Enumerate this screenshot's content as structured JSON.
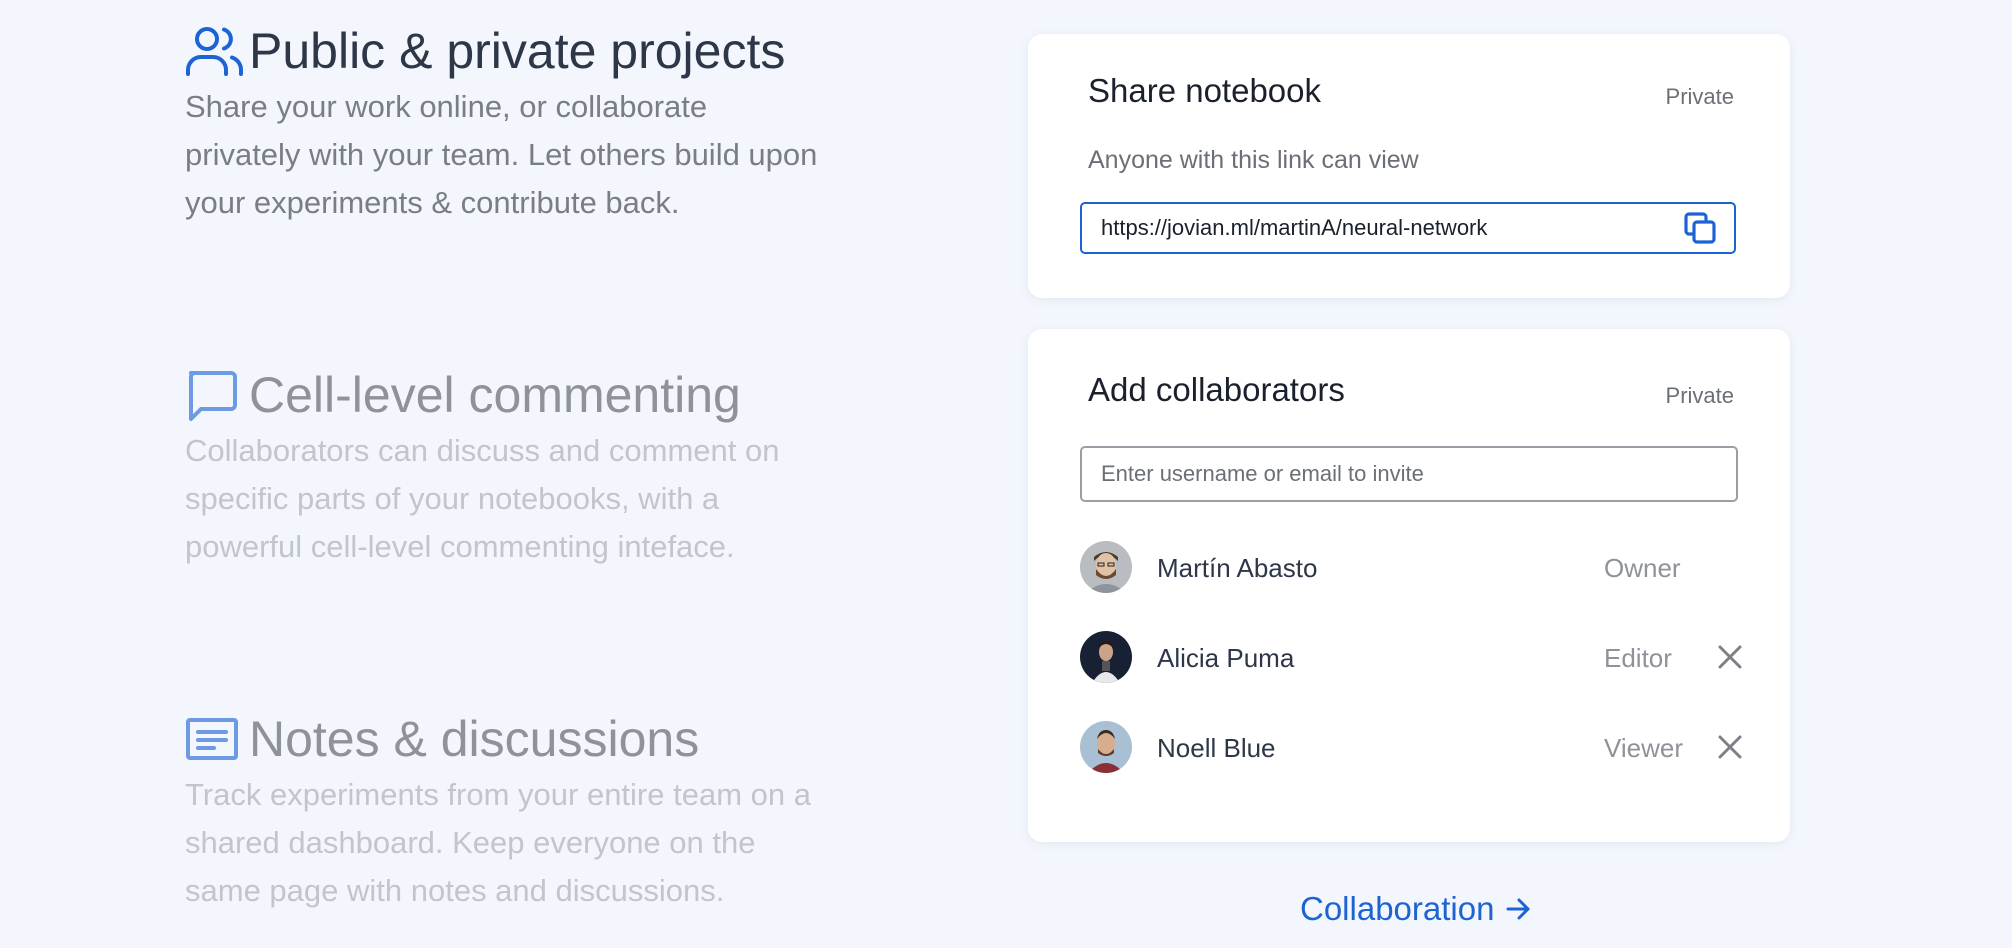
{
  "features": [
    {
      "icon": "users-icon",
      "title": "Public & private projects",
      "description": "Share your work online, or collaborate privately with your team. Let others build upon your experiments & contribute back."
    },
    {
      "icon": "comment-icon",
      "title": "Cell-level commenting",
      "description": "Collaborators can discuss and comment on specific parts of your notebooks, with a powerful cell-level commenting inteface."
    },
    {
      "icon": "notes-icon",
      "title": "Notes & discussions",
      "description": "Track experiments from your entire team on a shared dashboard. Keep everyone on the same page with notes and discussions."
    }
  ],
  "share_card": {
    "title": "Share notebook",
    "badge": "Private",
    "caption": "Anyone with this link can view",
    "link": "https://jovian.ml/martinA/neural-network",
    "copy_icon": "copy-icon"
  },
  "collab_card": {
    "title": "Add collaborators",
    "badge": "Private",
    "input_placeholder": "Enter username or email to invite",
    "people": [
      {
        "name": "Martín Abasto",
        "role": "Owner",
        "removable": false
      },
      {
        "name": "Alicia Puma",
        "role": "Editor",
        "removable": true
      },
      {
        "name": "Noell Blue",
        "role": "Viewer",
        "removable": true
      }
    ]
  },
  "footer_link": {
    "label": "Collaboration",
    "icon": "arrow-right-icon"
  },
  "colors": {
    "accent": "#1d63d3",
    "background": "#f3f7fd",
    "card": "#ffffff"
  }
}
